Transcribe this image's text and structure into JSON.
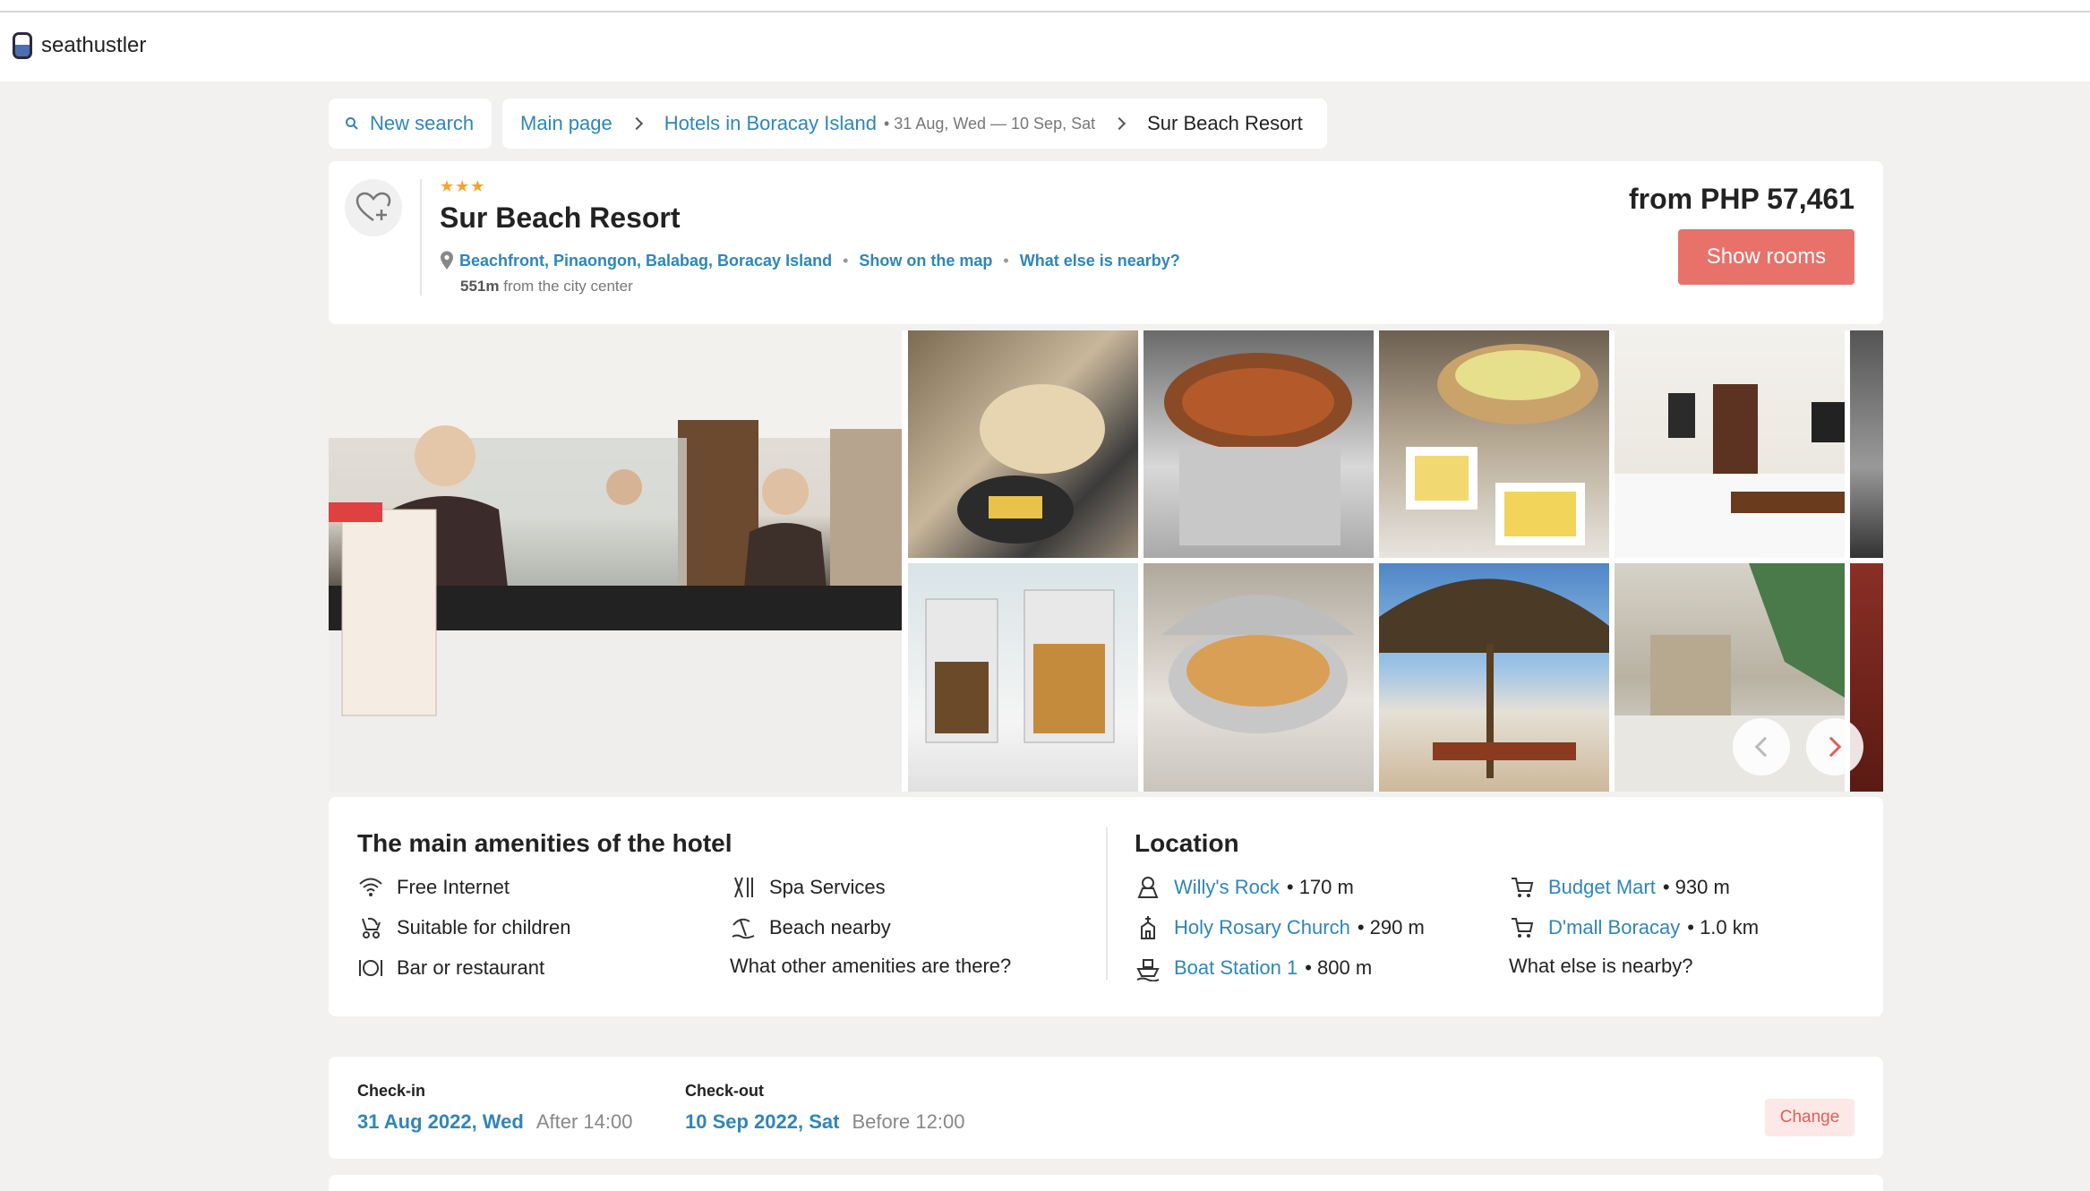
{
  "brand": {
    "name": "seathustler"
  },
  "breadcrumb": {
    "new_search": "New search",
    "main_page": "Main page",
    "hotels": "Hotels in Boracay Island",
    "dates": "• 31 Aug, Wed — 10 Sep, Sat",
    "current": "Sur Beach Resort"
  },
  "hotel": {
    "stars": "★★★",
    "name": "Sur Beach Resort",
    "address": "Beachfront, Pinaongon, Balabag, Boracay Island",
    "show_map": "Show on the map",
    "nearby": "What else is nearby?",
    "distance_value": "551m",
    "distance_text": "from the city center",
    "price": "from PHP 57,461",
    "show_rooms": "Show rooms"
  },
  "gallery": {
    "icons": [
      "reception-photo",
      "bread-photo",
      "stew-photo",
      "salad-photo",
      "bedroom-photo",
      "cereal-photo",
      "rice-photo",
      "beach-photo",
      "hallway-photo"
    ]
  },
  "amenities": {
    "title": "The main amenities of the hotel",
    "items": [
      "Free Internet",
      "Suitable for children",
      "Bar or restaurant",
      "Spa Services",
      "Beach nearby"
    ],
    "more": "What other amenities are there?"
  },
  "location": {
    "title": "Location",
    "places": [
      {
        "name": "Willy's Rock",
        "dist": "• 170 m"
      },
      {
        "name": "Holy Rosary Church",
        "dist": "• 290 m"
      },
      {
        "name": "Boat Station 1",
        "dist": "• 800 m"
      },
      {
        "name": "Budget Mart",
        "dist": "• 930 m"
      },
      {
        "name": "D'mall Boracay",
        "dist": "• 1.0 km"
      }
    ],
    "more": "What else is nearby?"
  },
  "checkin": {
    "label": "Check-in",
    "date": "31 Aug 2022, Wed",
    "time": "After 14:00"
  },
  "checkout": {
    "label": "Check-out",
    "date": "10 Sep 2022, Sat",
    "time": "Before 12:00"
  },
  "change": "Change",
  "colors": {
    "accent": "#e8716a",
    "link": "#2f86b7",
    "star": "#f4a428"
  }
}
